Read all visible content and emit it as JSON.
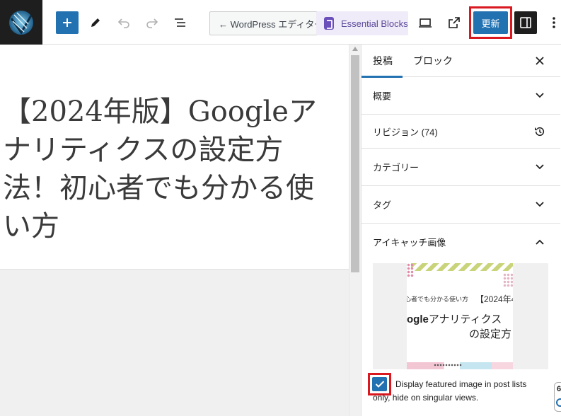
{
  "toolbar": {
    "back_label": "← WordPress エディター",
    "plugin_label": "Essential Blocks",
    "update_label": "更新",
    "icons": [
      "wordpress-logo-icon",
      "plus-icon",
      "pen-icon",
      "undo-icon",
      "redo-icon",
      "list-view-icon",
      "desktop-preview-icon",
      "external-link-icon",
      "sidebar-toggle-icon",
      "more-vertical-icon"
    ]
  },
  "editor": {
    "title": "【2024年版】Googleアナリティクスの設定方法！初心者でも分かる使い方"
  },
  "sidebar": {
    "tabs": [
      "投稿",
      "ブロック"
    ],
    "panels": [
      {
        "label": "概要",
        "icon": "chevron-down-icon"
      },
      {
        "label": "リビジョン (74)",
        "icon": "history-icon"
      },
      {
        "label": "カテゴリー",
        "icon": "chevron-down-icon"
      },
      {
        "label": "タグ",
        "icon": "chevron-down-icon"
      }
    ],
    "featured": {
      "label": "アイキャッチ画像",
      "image": {
        "subtitle": "心者でも分かる使い方",
        "year": "【2024年4",
        "line1_bold": "ogle",
        "line1_rest": "アナリティクス",
        "line2": "の設定方"
      },
      "checkbox_label_1": "Display featured image in post lists",
      "checkbox_label_2": "only, hide on singular views.",
      "checkbox_checked": true
    },
    "edge_badge": "6"
  },
  "colors": {
    "accent": "#2271b1",
    "highlight_border": "#d9181f",
    "dark": "#1e1e1e"
  }
}
